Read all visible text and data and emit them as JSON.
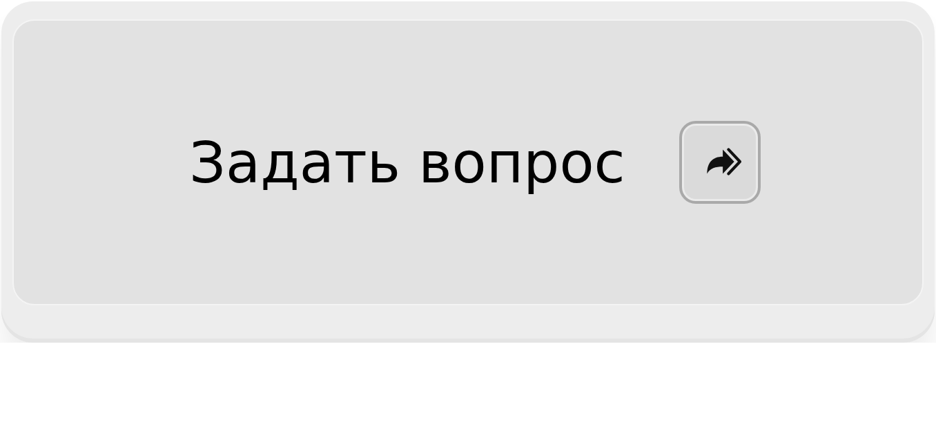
{
  "button": {
    "label": "Задать вопрос"
  }
}
